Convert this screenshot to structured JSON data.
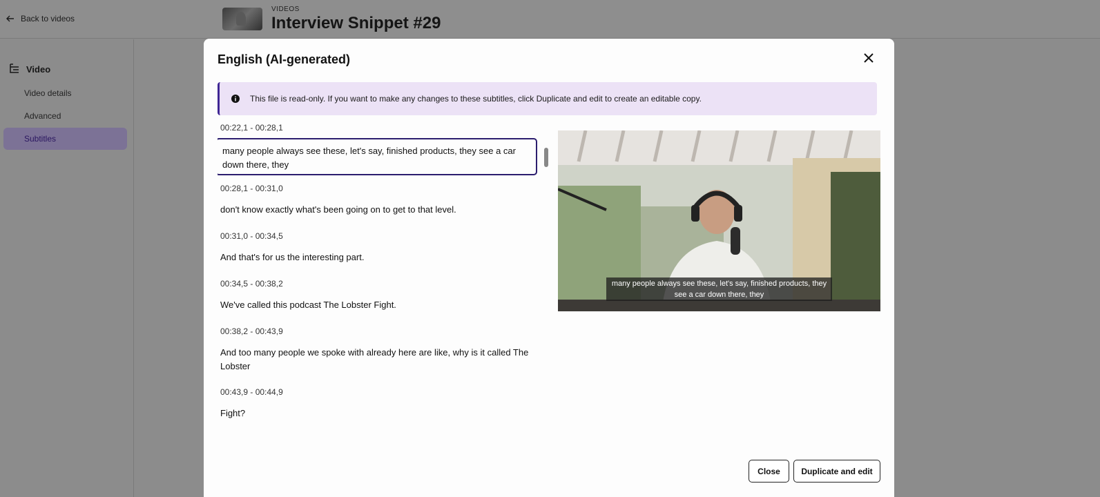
{
  "header": {
    "back_label": "Back to videos",
    "section_label": "VIDEOS",
    "title": "Interview Snippet #29"
  },
  "sidebar": {
    "heading": "Video",
    "items": [
      {
        "label": "Video details",
        "active": false
      },
      {
        "label": "Advanced",
        "active": false
      },
      {
        "label": "Subtitles",
        "active": true
      }
    ]
  },
  "modal": {
    "title": "English (AI-generated)",
    "notice": "This file is read-only. If you want to make any changes to these subtitles, click Duplicate and edit to create an editable copy.",
    "cut_timestamp": "00:22,1 - 00:28,1",
    "subtitles": [
      {
        "timestamp": "",
        "text": "many people always see these, let's say, finished products, they see a car down there, they"
      },
      {
        "timestamp": "00:28,1 - 00:31,0",
        "text": "don't know exactly what's been going on to get to that level."
      },
      {
        "timestamp": "00:31,0 - 00:34,5",
        "text": "And that's for us the interesting part."
      },
      {
        "timestamp": "00:34,5 - 00:38,2",
        "text": "We've called this podcast The Lobster Fight."
      },
      {
        "timestamp": "00:38,2 - 00:43,9",
        "text": "And too many people we spoke with already here are like, why is it called The Lobster"
      },
      {
        "timestamp": "00:43,9 - 00:44,9",
        "text": "Fight?"
      }
    ],
    "video_caption": "many people always see these, let's say, finished products, they see a car down there, they",
    "close_label": "Close",
    "duplicate_label": "Duplicate and edit"
  },
  "icons": {
    "back": "arrow-left-icon",
    "video": "tree-structure-icon",
    "info": "info-icon",
    "close": "close-icon"
  },
  "colors": {
    "accent": "#2b1d6e",
    "notice_bg": "#ece2f6",
    "active_nav_bg": "#7c7296"
  }
}
